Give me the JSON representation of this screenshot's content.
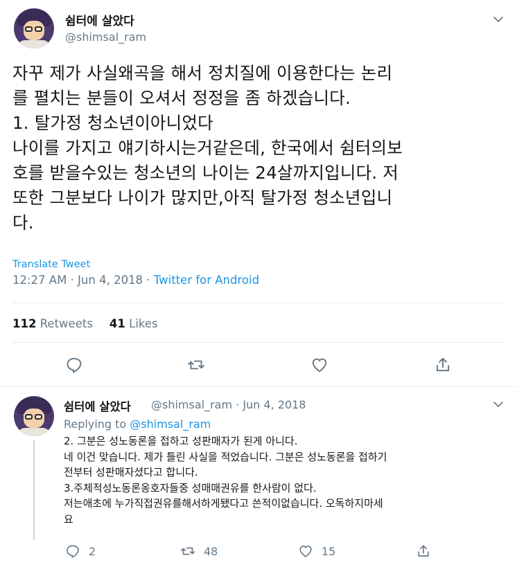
{
  "main_tweet": {
    "display_name": "쉼터에 살았다",
    "handle": "@shimsal_ram",
    "text": "자꾸 제가 사실왜곡을 해서 정치질에 이용한다는 논리\n를 펼치는 분들이 오셔서 정정을 좀 하겠습니다.\n1. 탈가정 청소년이아니었다\n나이를 가지고 얘기하시는거같은데, 한국에서 쉼터의보\n호를 받을수있는 청소년의 나이는 24살까지입니다. 저\n또한 그분보다 나이가 많지만,아직 탈가정 청소년입니\n다.",
    "translate_label": "Translate Tweet",
    "time": "12:27 AM · Jun 4, 2018 · ",
    "source": "Twitter for Android",
    "retweets_count": "112",
    "retweets_label": "Retweets",
    "likes_count": "41",
    "likes_label": "Likes",
    "icons": {
      "reply": "reply-icon",
      "retweet": "retweet-icon",
      "like": "heart-icon",
      "share": "share-icon",
      "menu": "chevron-down-icon"
    }
  },
  "reply_tweet": {
    "display_name": "쉼터에 살았다",
    "handle_and_date": "@shimsal_ram · Jun 4, 2018",
    "replying_prefix": "Replying to ",
    "replying_to": "@shimsal_ram",
    "text": "2. 그분은 성노동론을 접하고 성판매자가 된게 아니다.\n네 이건 맞습니다. 제가 틀린 사실을 적었습니다. 그분은 성노동론을 접하기\n전부터 성판매자셨다고 합니다.\n3.주체적성노동론옹호자들중 성매매권유를 한사람이 없다.\n저는애초에 누가직접권유를해서하게됐다고 쓴적이없습니다. 오독하지마세\n요",
    "reply_count": "2",
    "retweet_count": "48",
    "like_count": "15"
  },
  "colors": {
    "text": "#14171a",
    "secondary": "#657786",
    "link": "#1b95e0",
    "divider": "#e6ecf0"
  }
}
